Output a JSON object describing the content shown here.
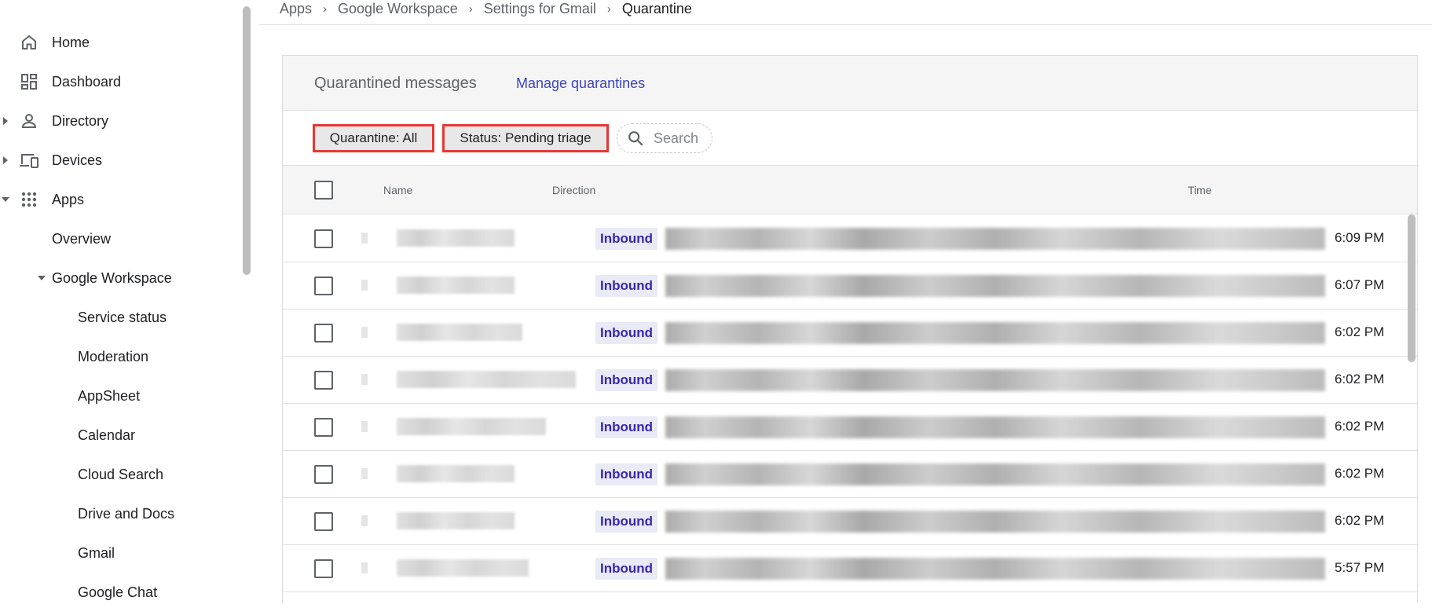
{
  "breadcrumb": {
    "items": [
      "Apps",
      "Google Workspace",
      "Settings for Gmail"
    ],
    "current": "Quarantine"
  },
  "sidebar": {
    "home": "Home",
    "dashboard": "Dashboard",
    "directory": "Directory",
    "devices": "Devices",
    "apps": "Apps",
    "overview": "Overview",
    "google_workspace": "Google Workspace",
    "children": [
      "Service status",
      "Moderation",
      "AppSheet",
      "Calendar",
      "Cloud Search",
      "Drive and Docs",
      "Gmail",
      "Google Chat"
    ]
  },
  "card": {
    "title": "Quarantined messages",
    "manage_link": "Manage quarantines"
  },
  "filters": {
    "quarantine": "Quarantine: All",
    "status": "Status: Pending triage",
    "search_placeholder": "Search"
  },
  "table": {
    "columns": {
      "name": "Name",
      "direction": "Direction",
      "time": "Time"
    },
    "rows": [
      {
        "direction": "Inbound",
        "time": "6:09 PM"
      },
      {
        "direction": "Inbound",
        "time": "6:07 PM"
      },
      {
        "direction": "Inbound",
        "time": "6:02 PM"
      },
      {
        "direction": "Inbound",
        "time": "6:02 PM"
      },
      {
        "direction": "Inbound",
        "time": "6:02 PM"
      },
      {
        "direction": "Inbound",
        "time": "6:02 PM"
      },
      {
        "direction": "Inbound",
        "time": "6:02 PM"
      },
      {
        "direction": "Inbound",
        "time": "5:57 PM"
      }
    ]
  },
  "colors": {
    "accent_link": "#3c43c8",
    "badge_text": "#3726b0",
    "badge_bg": "#e8eaf6",
    "highlight_border": "#e53935"
  }
}
